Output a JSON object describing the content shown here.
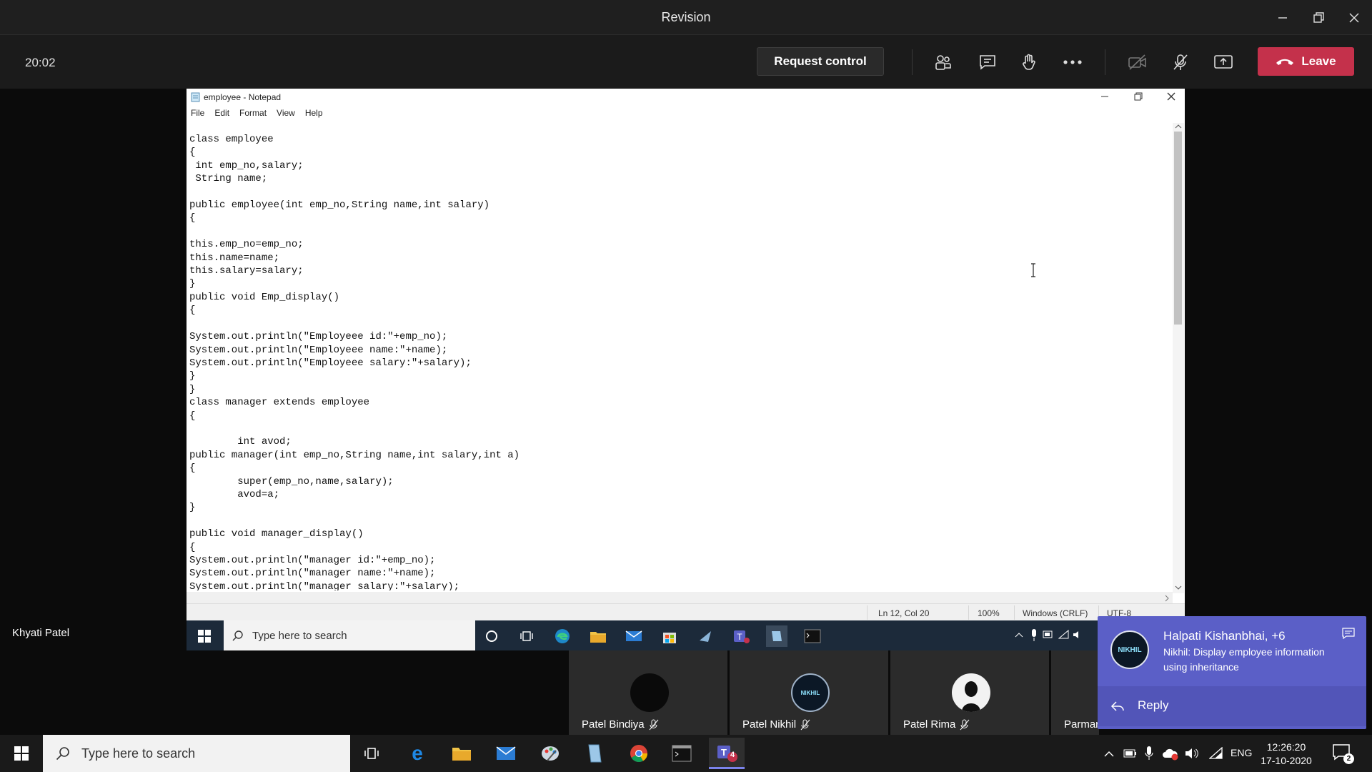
{
  "window": {
    "title": "Revision"
  },
  "meeting": {
    "timer": "20:02",
    "request_control_label": "Request control",
    "leave_label": "Leave",
    "presenter_name": "Khyati Patel"
  },
  "notepad": {
    "title": "employee - Notepad",
    "menu": [
      "File",
      "Edit",
      "Format",
      "View",
      "Help"
    ],
    "code_lines": [
      "class employee",
      "{",
      " int emp_no,salary;",
      " String name;",
      "",
      "public employee(int emp_no,String name,int salary)",
      "{",
      "",
      "this.emp_no=emp_no;",
      "this.name=name;",
      "this.salary=salary;",
      "}",
      "public void Emp_display()",
      "{",
      "",
      "System.out.println(\"Employeee id:\"+emp_no);",
      "System.out.println(\"Employeee name:\"+name);",
      "System.out.println(\"Employeee salary:\"+salary);",
      "}",
      "}",
      "class manager extends employee",
      "{",
      "",
      "        int avod;",
      "public manager(int emp_no,String name,int salary,int a)",
      "{",
      "        super(emp_no,name,salary);",
      "        avod=a;",
      "}",
      "",
      "public void manager_display()",
      "{",
      "System.out.println(\"manager id:\"+emp_no);",
      "System.out.println(\"manager name:\"+name);",
      "System.out.println(\"manager salary:\"+salary);"
    ],
    "status": {
      "position": "Ln 12, Col 20",
      "zoom": "100%",
      "line_ending": "Windows (CRLF)",
      "encoding": "UTF-8"
    }
  },
  "inner_taskbar": {
    "search_placeholder": "Type here to search"
  },
  "participants": [
    {
      "name": "Patel Bindiya",
      "avatar_color": "#0a0a0a"
    },
    {
      "name": "Patel Nikhil",
      "avatar_color": "#0c1826"
    },
    {
      "name": "Patel Rima",
      "avatar_color": "#f2f2f2"
    },
    {
      "name": "Parmar",
      "avatar_color": "#2b2b2b"
    }
  ],
  "toast": {
    "title": "Halpati Kishanbhai, +6",
    "message": "Nikhil: Display employee information using inheritance",
    "reply_label": "Reply",
    "avatar_text": "NIKHIL"
  },
  "taskbar": {
    "search_placeholder": "Type here to search",
    "language": "ENG",
    "time": "12:26:20",
    "date": "17-10-2020",
    "teams_badge": "4",
    "notification_count": "2"
  },
  "colors": {
    "leave_red": "#c4314b",
    "toast_purple": "#5b5fc7",
    "taskbar_dark": "#1a1a1a"
  }
}
